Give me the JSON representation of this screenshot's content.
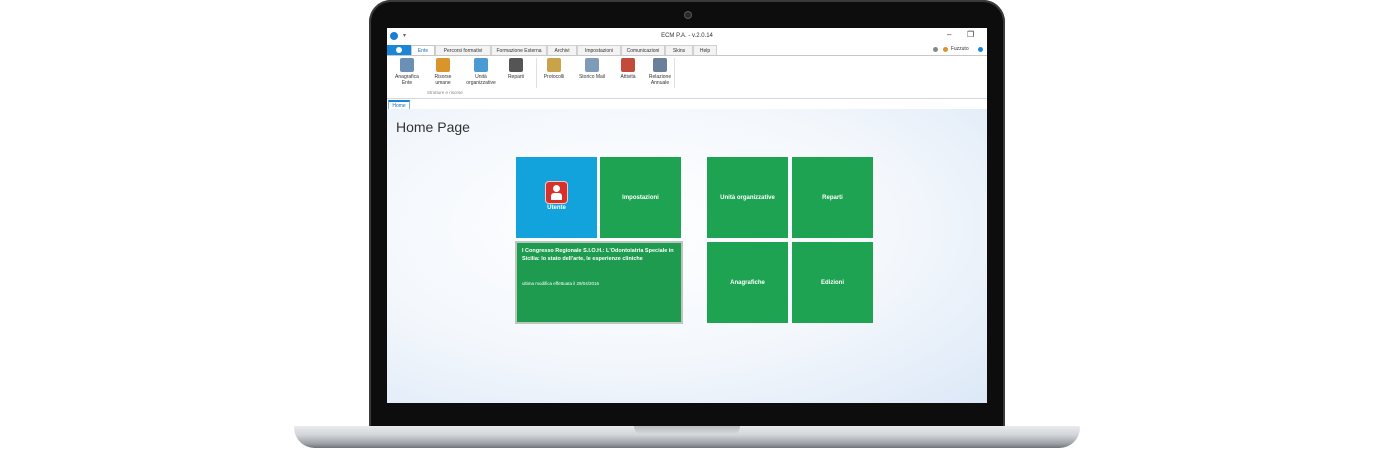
{
  "window": {
    "title": "ECM P.A. - v.2.0.14",
    "quick_access": "▾"
  },
  "ribbon_tabs": [
    {
      "label": "Ente"
    },
    {
      "label": "Percorsi formativi"
    },
    {
      "label": "Formazione Esterna"
    },
    {
      "label": "Archivi"
    },
    {
      "label": "Impostazioni"
    },
    {
      "label": "Comunicazioni"
    },
    {
      "label": "Skins"
    },
    {
      "label": "Help"
    }
  ],
  "user": {
    "name": "Fuzzuto"
  },
  "ribbon": {
    "buttons": [
      {
        "label": "Anagrafica Ente",
        "icon": "building-icon",
        "color": "#6b8fb5"
      },
      {
        "label": "Risorse umane",
        "icon": "people-icon",
        "color": "#d9952b"
      },
      {
        "label": "Unità organizzative",
        "icon": "org-unit-icon",
        "color": "#4a9ad4"
      },
      {
        "label": "Reparti",
        "icon": "hierarchy-icon",
        "color": "#555555"
      },
      {
        "label": "Protocolli",
        "icon": "clipboard-icon",
        "color": "#c9a24a"
      },
      {
        "label": "Storico Mail",
        "icon": "mail-history-icon",
        "color": "#7f9bb8"
      },
      {
        "label": "Attività",
        "icon": "calendar-icon",
        "color": "#c24b3c"
      },
      {
        "label": "Relazione Annuale",
        "icon": "report-icon",
        "color": "#6a7f99"
      }
    ],
    "group_label": "Strutture e risorse"
  },
  "doc_tabs": [
    {
      "label": "Home"
    }
  ],
  "page": {
    "title": "Home Page"
  },
  "tiles": {
    "utente": "Utente",
    "impostazioni": "Impostazioni",
    "unita": "Unità organizzative",
    "reparti": "Reparti",
    "anagrafiche": "Anagrafiche",
    "edizioni": "Edizioni",
    "news": {
      "title": "I Congresso Regionale S.I.O.H.: L'Odontoiatria Speciale in Sicilia: lo stato dell'arte, le esperienze cliniche",
      "date": "ultima modifica effettuata il 29/04/2016"
    }
  },
  "colors": {
    "tile_green": "#1ea352",
    "tile_blue": "#13a3dc",
    "accent": "#1a86d8"
  }
}
